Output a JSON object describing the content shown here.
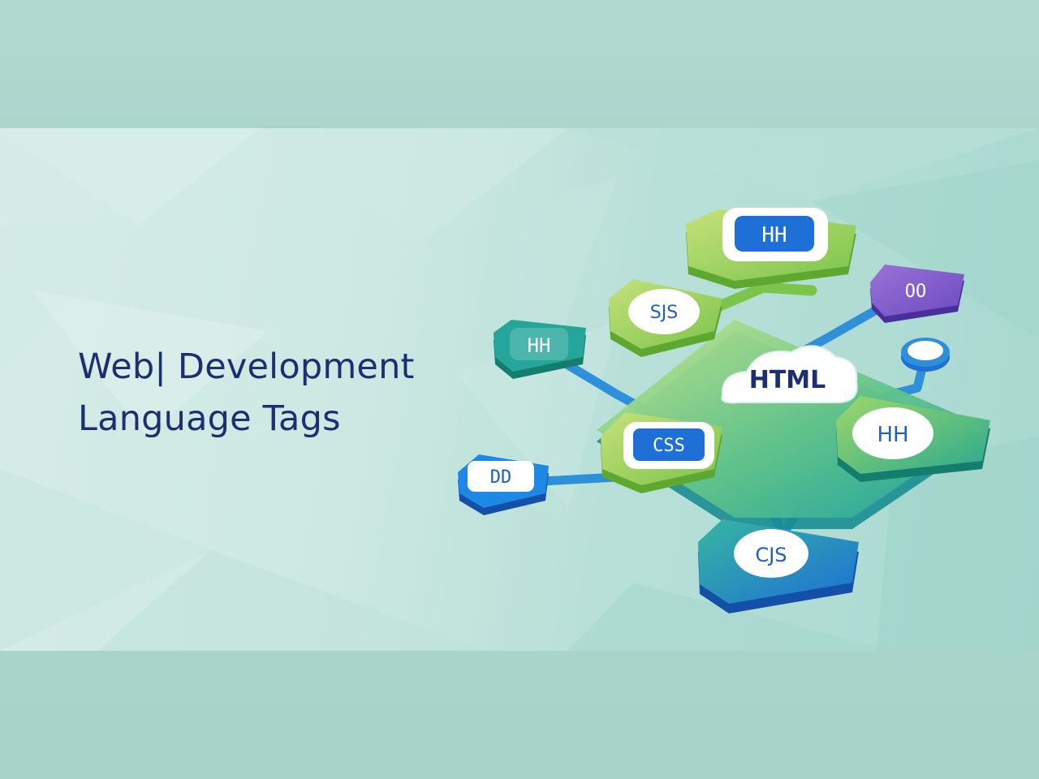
{
  "banner": {
    "title_line1": "Web| Development",
    "title_line2": "Language Tags"
  },
  "diagram": {
    "center_tag": "HTML",
    "node_glyphs": [
      "HH",
      "SJS",
      "OO",
      "HH",
      "CSS",
      "HH",
      "CJS",
      "DD"
    ]
  },
  "colors": {
    "title_navy": "#1c2f72",
    "node_green": "#8bc34a",
    "node_teal": "#26a69a",
    "node_blue": "#1e88e5",
    "node_purple": "#7e57c2",
    "connector_blue": "#2f8fd8"
  }
}
